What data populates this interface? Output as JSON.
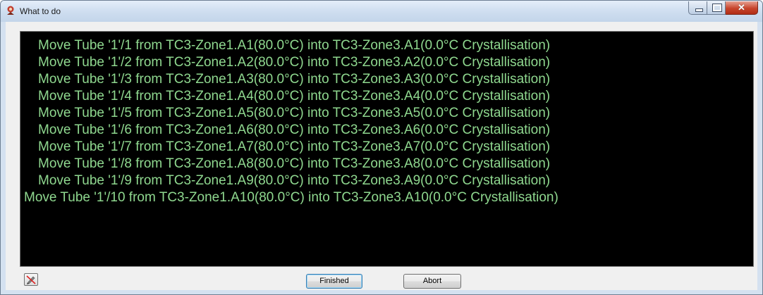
{
  "window": {
    "title": "What to do"
  },
  "instructions": [
    "Move Tube '1'/1 from TC3-Zone1.A1(80.0°C) into TC3-Zone3.A1(0.0°C Crystallisation)",
    "Move Tube '1'/2 from TC3-Zone1.A2(80.0°C) into TC3-Zone3.A2(0.0°C Crystallisation)",
    "Move Tube '1'/3 from TC3-Zone1.A3(80.0°C) into TC3-Zone3.A3(0.0°C Crystallisation)",
    "Move Tube '1'/4 from TC3-Zone1.A4(80.0°C) into TC3-Zone3.A4(0.0°C Crystallisation)",
    "Move Tube '1'/5 from TC3-Zone1.A5(80.0°C) into TC3-Zone3.A5(0.0°C Crystallisation)",
    "Move Tube '1'/6 from TC3-Zone1.A6(80.0°C) into TC3-Zone3.A6(0.0°C Crystallisation)",
    "Move Tube '1'/7 from TC3-Zone1.A7(80.0°C) into TC3-Zone3.A7(0.0°C Crystallisation)",
    "Move Tube '1'/8 from TC3-Zone1.A8(80.0°C) into TC3-Zone3.A8(0.0°C Crystallisation)",
    "Move Tube '1'/9 from TC3-Zone1.A9(80.0°C) into TC3-Zone3.A9(0.0°C Crystallisation)",
    "Move Tube '1'/10 from TC3-Zone1.A10(80.0°C) into TC3-Zone3.A10(0.0°C Crystallisation)"
  ],
  "buttons": {
    "finished": "Finished",
    "abort": "Abort"
  },
  "colors": {
    "console_bg": "#000000",
    "console_text": "#8fd88f"
  },
  "icons": {
    "app": "app-icon",
    "pen": "pen-icon"
  }
}
